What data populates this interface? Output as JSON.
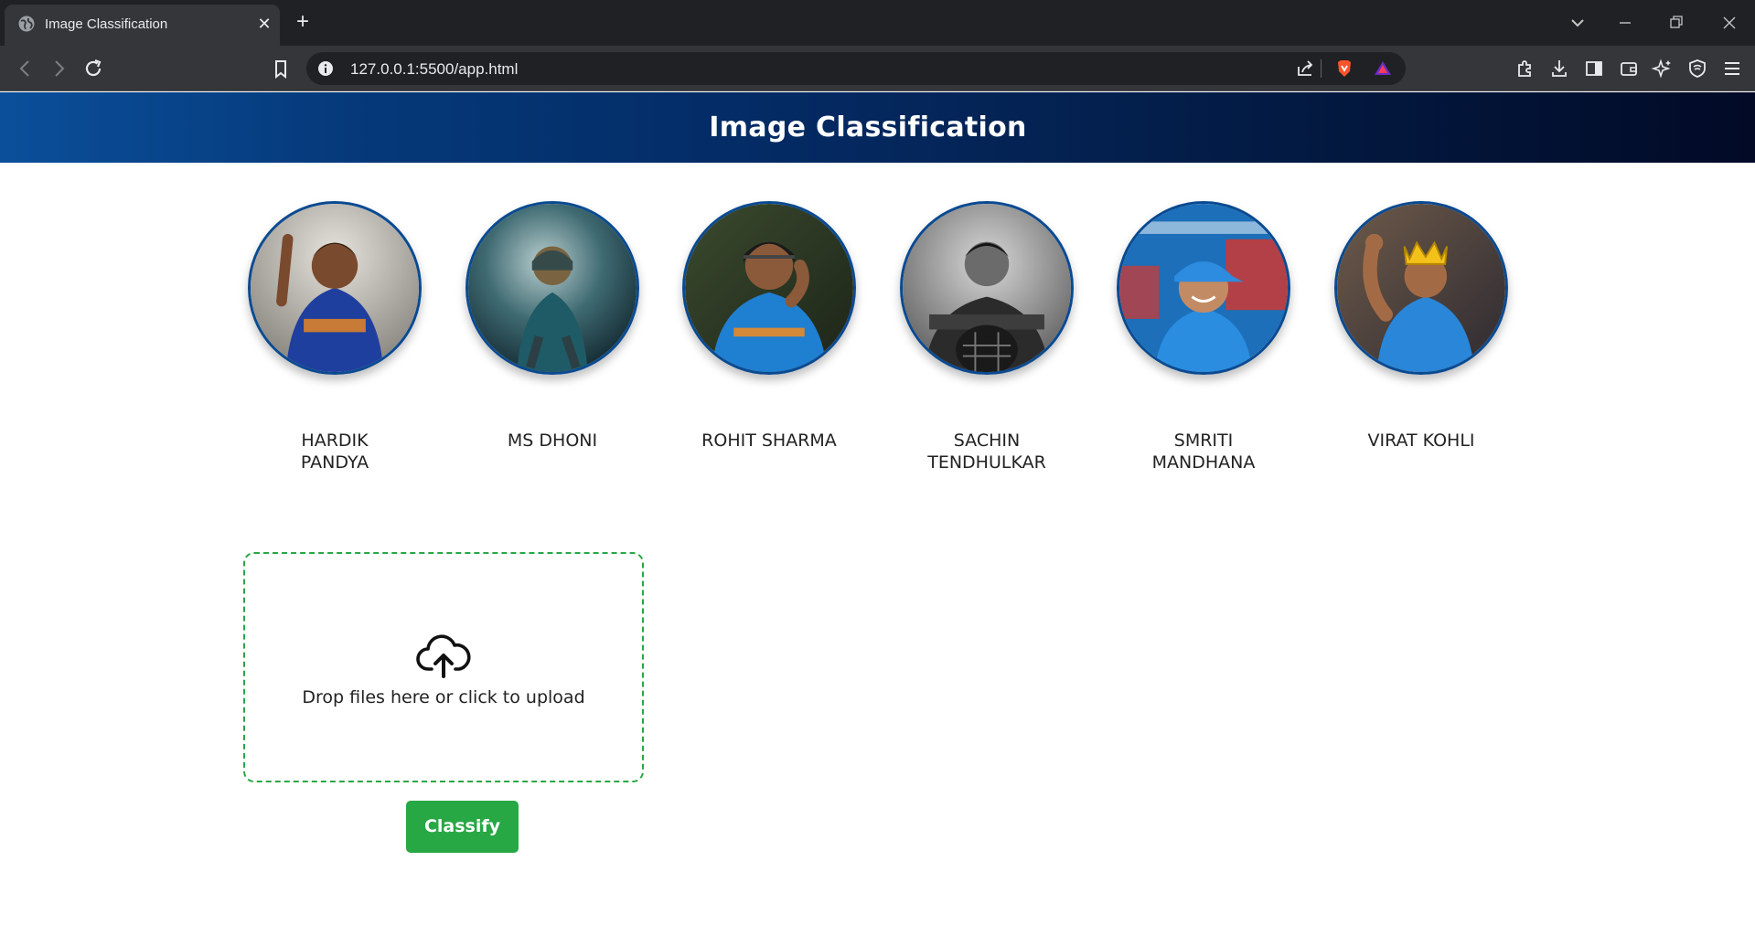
{
  "browser": {
    "tab_title": "Image Classification",
    "url": "127.0.0.1:5500/app.html"
  },
  "page": {
    "title": "Image Classification",
    "players": [
      {
        "name": "HARDIK\nPANDYA",
        "photo_icon": "cricketer-photo"
      },
      {
        "name": "MS DHONI",
        "photo_icon": "cricketer-photo"
      },
      {
        "name": "ROHIT SHARMA",
        "photo_icon": "cricketer-photo"
      },
      {
        "name": "SACHIN\nTENDHULKAR",
        "photo_icon": "cricketer-photo"
      },
      {
        "name": "SMRITI\nMANDHANA",
        "photo_icon": "cricketer-photo"
      },
      {
        "name": "VIRAT KOHLI",
        "photo_icon": "cricketer-photo"
      }
    ],
    "upload": {
      "text": "Drop files here or click to upload",
      "icon": "cloud-upload-icon"
    },
    "classify_label": "Classify"
  },
  "colors": {
    "header_start": "#0b4f9a",
    "header_end": "#020a26",
    "accent_green": "#28a745",
    "avatar_border": "#0a4a91"
  }
}
